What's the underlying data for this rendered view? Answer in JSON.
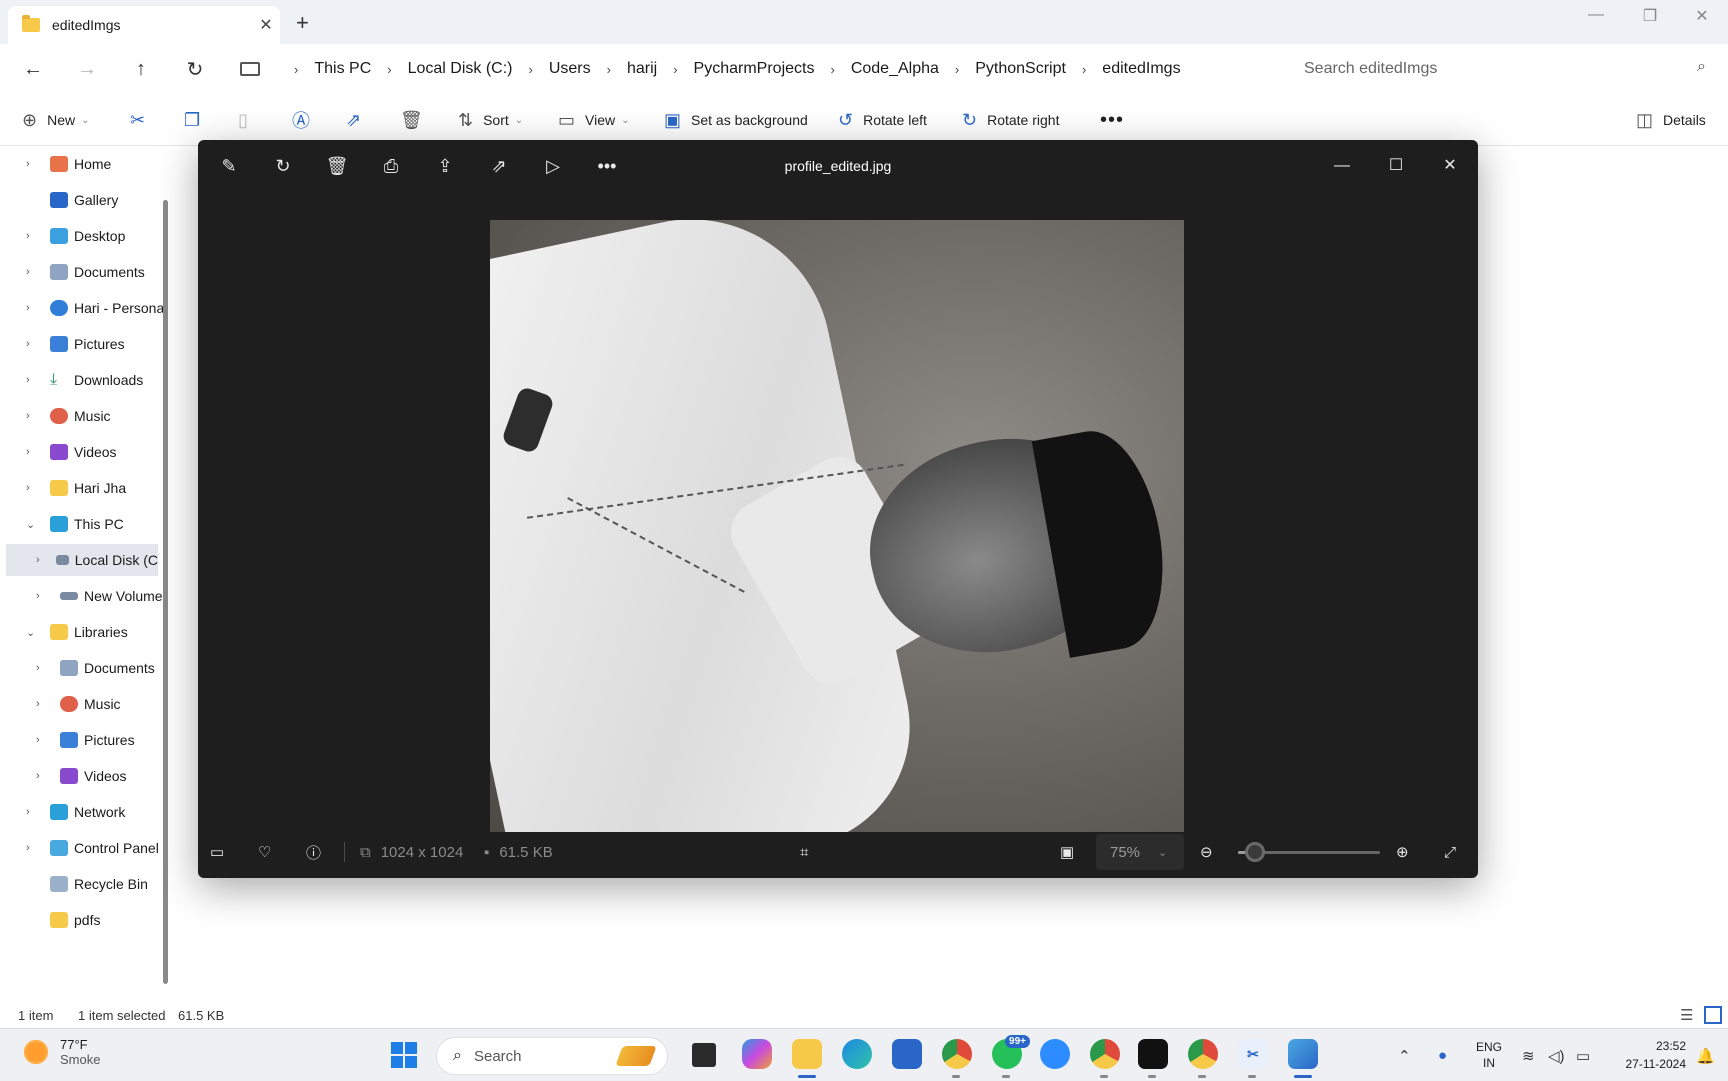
{
  "explorer": {
    "tab_title": "editedImgs",
    "breadcrumbs": [
      "This PC",
      "Local Disk (C:)",
      "Users",
      "harij",
      "PycharmProjects",
      "Code_Alpha",
      "PythonScript",
      "editedImgs"
    ],
    "search_placeholder": "Search editedImgs",
    "commands": {
      "new": "New",
      "sort": "Sort",
      "view": "View",
      "set_background": "Set as background",
      "rotate_left": "Rotate left",
      "rotate_right": "Rotate right",
      "details": "Details"
    },
    "nav_items": [
      {
        "label": "Home",
        "icon": "home-icon",
        "expander": "›"
      },
      {
        "label": "Gallery",
        "icon": "gallery-icon",
        "expander": ""
      },
      {
        "label": "Desktop",
        "icon": "desktop-icon",
        "expander": "›"
      },
      {
        "label": "Documents",
        "icon": "documents-icon",
        "expander": "›"
      },
      {
        "label": "Hari - Persona",
        "icon": "onedrive-icon",
        "expander": "›"
      },
      {
        "label": "Pictures",
        "icon": "pictures-icon",
        "expander": "›"
      },
      {
        "label": "Downloads",
        "icon": "downloads-icon",
        "expander": "›"
      },
      {
        "label": "Music",
        "icon": "music-icon",
        "expander": "›"
      },
      {
        "label": "Videos",
        "icon": "videos-icon",
        "expander": "›"
      },
      {
        "label": "Hari Jha",
        "icon": "folder-icon",
        "expander": "›"
      },
      {
        "label": "This PC",
        "icon": "this-pc-icon",
        "expander": "⌄"
      },
      {
        "label": "Local Disk (C",
        "icon": "drive-icon",
        "expander": "›"
      },
      {
        "label": "New Volume",
        "icon": "drive-icon",
        "expander": "›"
      },
      {
        "label": "Libraries",
        "icon": "folder-icon",
        "expander": "⌄"
      },
      {
        "label": "Documents",
        "icon": "documents-icon",
        "expander": "›"
      },
      {
        "label": "Music",
        "icon": "music-icon",
        "expander": "›"
      },
      {
        "label": "Pictures",
        "icon": "pictures-icon",
        "expander": "›"
      },
      {
        "label": "Videos",
        "icon": "videos-icon",
        "expander": "›"
      },
      {
        "label": "Network",
        "icon": "network-icon",
        "expander": "›"
      },
      {
        "label": "Control Panel",
        "icon": "control-panel-icon",
        "expander": "›"
      },
      {
        "label": "Recycle Bin",
        "icon": "recycle-bin-icon",
        "expander": ""
      },
      {
        "label": "pdfs",
        "icon": "folder-icon",
        "expander": ""
      }
    ],
    "status": {
      "count": "1 item",
      "selected": "1 item selected",
      "size": "61.5 KB"
    }
  },
  "viewer": {
    "title": "profile_edited.jpg",
    "dimensions": "1024 x 1024",
    "file_size": "61.5 KB",
    "zoom": "75%",
    "zoom_fraction": 0.12
  },
  "taskbar": {
    "weather_temp": "77°F",
    "weather_cond": "Smoke",
    "search_label": "Search",
    "notification_badge": "99+",
    "lang_top": "ENG",
    "lang_bottom": "IN",
    "time": "23:52",
    "date": "27-11-2024"
  },
  "colors": {
    "accent": "#2a66c8",
    "viewer_bg": "#1e1e1e",
    "selected_nav": "#e3e6ec"
  }
}
